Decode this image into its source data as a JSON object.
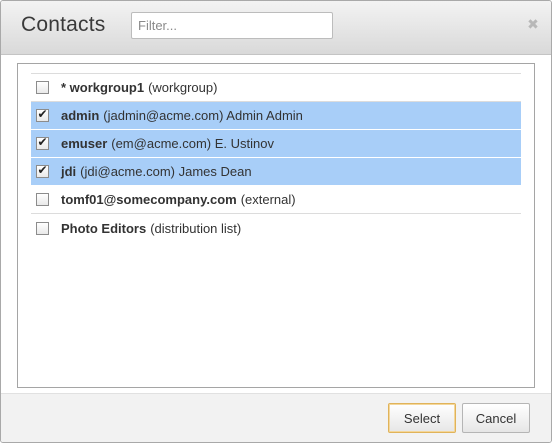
{
  "dialog": {
    "title": "Contacts",
    "filter": {
      "placeholder": "Filter...",
      "value": ""
    },
    "close_glyph": "✖"
  },
  "contacts": [
    {
      "name": "* workgroup1",
      "detail": "(workgroup)",
      "checked": false
    },
    {
      "name": "admin",
      "detail": "(jadmin@acme.com) Admin Admin",
      "checked": true
    },
    {
      "name": "emuser",
      "detail": "(em@acme.com) E. Ustinov",
      "checked": true
    },
    {
      "name": "jdi",
      "detail": "(jdi@acme.com) James Dean",
      "checked": true
    },
    {
      "name": "tomf01@somecompany.com",
      "detail": "(external)",
      "checked": false
    },
    {
      "name": "Photo Editors",
      "detail": "(distribution list)",
      "checked": false
    }
  ],
  "check_glyph": "✔",
  "footer": {
    "select_label": "Select",
    "cancel_label": "Cancel"
  },
  "colors": {
    "selected_row": "#a8cef8",
    "select_button_border": "#e0b35a"
  }
}
